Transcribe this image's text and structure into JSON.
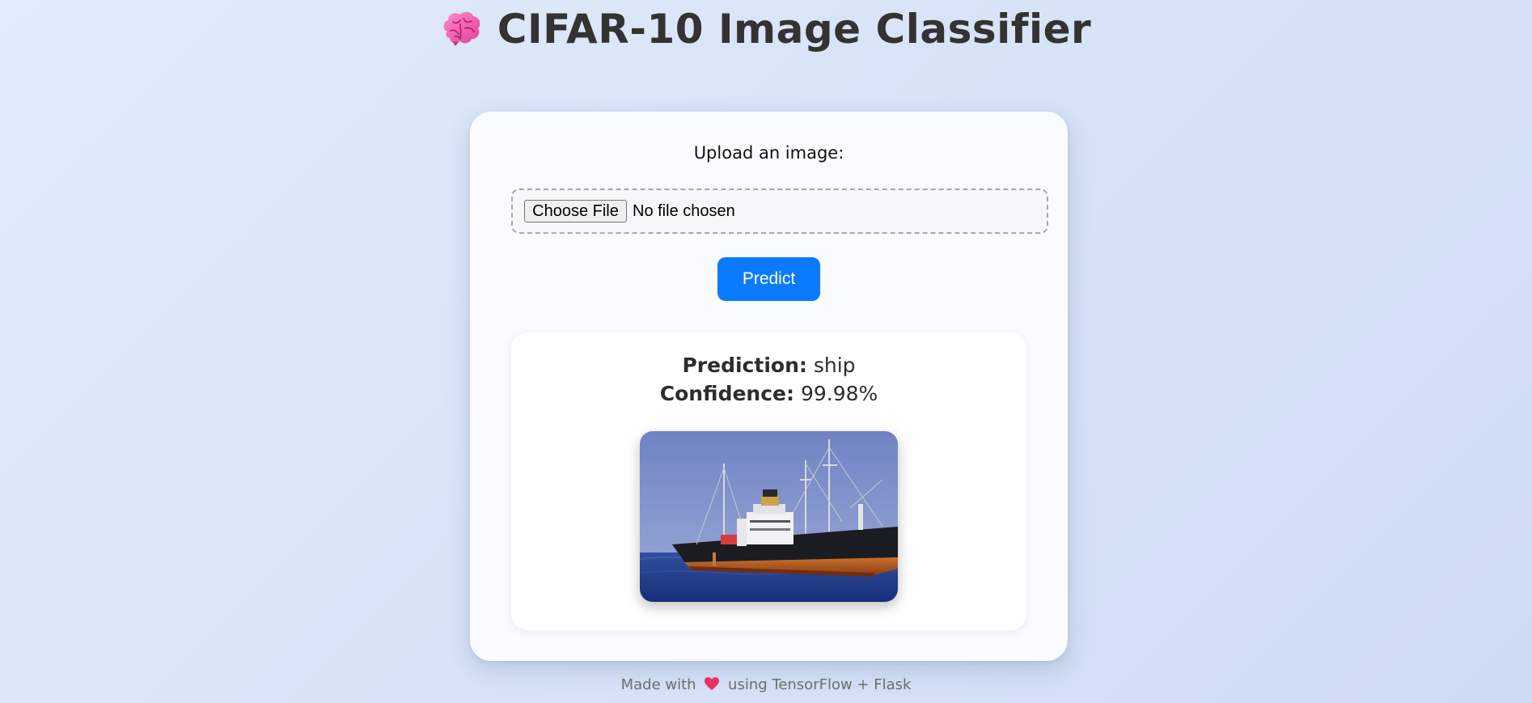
{
  "header": {
    "title": "CIFAR-10 Image Classifier",
    "icon": "brain-icon"
  },
  "form": {
    "upload_label": "Upload an image:",
    "file_button_label": "Choose File",
    "file_status": "No file chosen",
    "predict_label": "Predict"
  },
  "result": {
    "prediction_label": "Prediction:",
    "prediction_value": "ship",
    "confidence_label": "Confidence:",
    "confidence_value": "99.98%",
    "image_icon": "ship-photo"
  },
  "footer": {
    "before": "Made with",
    "icon": "heart-icon",
    "after": "using TensorFlow + Flask"
  },
  "colors": {
    "accent": "#0a7bff",
    "title_text": "#333333",
    "heart": "#e8335f",
    "brain": "#ff6fb5"
  }
}
